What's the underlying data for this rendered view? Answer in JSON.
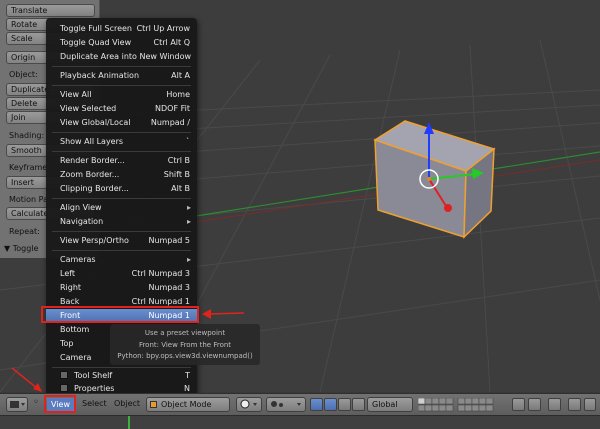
{
  "toolshelf": {
    "buttons": [
      "Translate",
      "Rotate",
      "Scale",
      "Origin",
      "Duplicate",
      "Delete",
      "Join",
      "Smooth",
      "Insert",
      "Calculate"
    ],
    "labels": [
      "Object:",
      "Shading:",
      "Keyframe",
      "Motion Pa",
      "Repeat:"
    ],
    "toggle": "▼ Toggle"
  },
  "view_menu": {
    "items": [
      {
        "label": "Toggle Full Screen",
        "shortcut": "Ctrl Up Arrow"
      },
      {
        "label": "Toggle Quad View",
        "shortcut": "Ctrl Alt Q"
      },
      {
        "label": "Duplicate Area into New Window",
        "shortcut": ""
      },
      {
        "label": "Playback Animation",
        "shortcut": "Alt A"
      },
      {
        "label": "View All",
        "shortcut": "Home"
      },
      {
        "label": "View Selected",
        "shortcut": "NDOF Fit"
      },
      {
        "label": "View Global/Local",
        "shortcut": "Numpad /"
      },
      {
        "label": "Show All Layers",
        "shortcut": "`"
      },
      {
        "label": "Render Border...",
        "shortcut": "Ctrl B"
      },
      {
        "label": "Zoom Border...",
        "shortcut": "Shift B"
      },
      {
        "label": "Clipping Border...",
        "shortcut": "Alt B"
      },
      {
        "label": "Align View",
        "shortcut": "▸"
      },
      {
        "label": "Navigation",
        "shortcut": "▸"
      },
      {
        "label": "View Persp/Ortho",
        "shortcut": "Numpad 5"
      },
      {
        "label": "Cameras",
        "shortcut": "▸"
      },
      {
        "label": "Left",
        "shortcut": "Ctrl Numpad 3"
      },
      {
        "label": "Right",
        "shortcut": "Numpad 3"
      },
      {
        "label": "Back",
        "shortcut": "Ctrl Numpad 1"
      },
      {
        "label": "Front",
        "shortcut": "Numpad 1"
      },
      {
        "label": "Bottom",
        "shortcut": ""
      },
      {
        "label": "Top",
        "shortcut": ""
      },
      {
        "label": "Camera",
        "shortcut": ""
      },
      {
        "label": "Tool Shelf",
        "shortcut": "T"
      },
      {
        "label": "Properties",
        "shortcut": "N"
      }
    ]
  },
  "tooltip": {
    "line1": "Use a preset viewpoint",
    "line2": "Front: View From the Front",
    "line3": "Python: bpy.ops.view3d.viewnumpad()"
  },
  "header": {
    "view": "View",
    "select": "Select",
    "object": "Object",
    "mode": "Object Mode",
    "orientation": "Global"
  },
  "colors": {
    "highlight": "#5b7cbf",
    "annotation_red": "#e0241c",
    "cube": "#8c8c99",
    "selection_outline": "#f0a030"
  },
  "icons": [
    "editor-type-icon",
    "menu-toggle-icon",
    "mode-object-icon",
    "viewport-shading-icon",
    "pivot-icon",
    "manipulator-icon",
    "translate-icon",
    "rotate-icon",
    "scale-icon",
    "layer-icon",
    "lock-icon",
    "render-icon"
  ]
}
